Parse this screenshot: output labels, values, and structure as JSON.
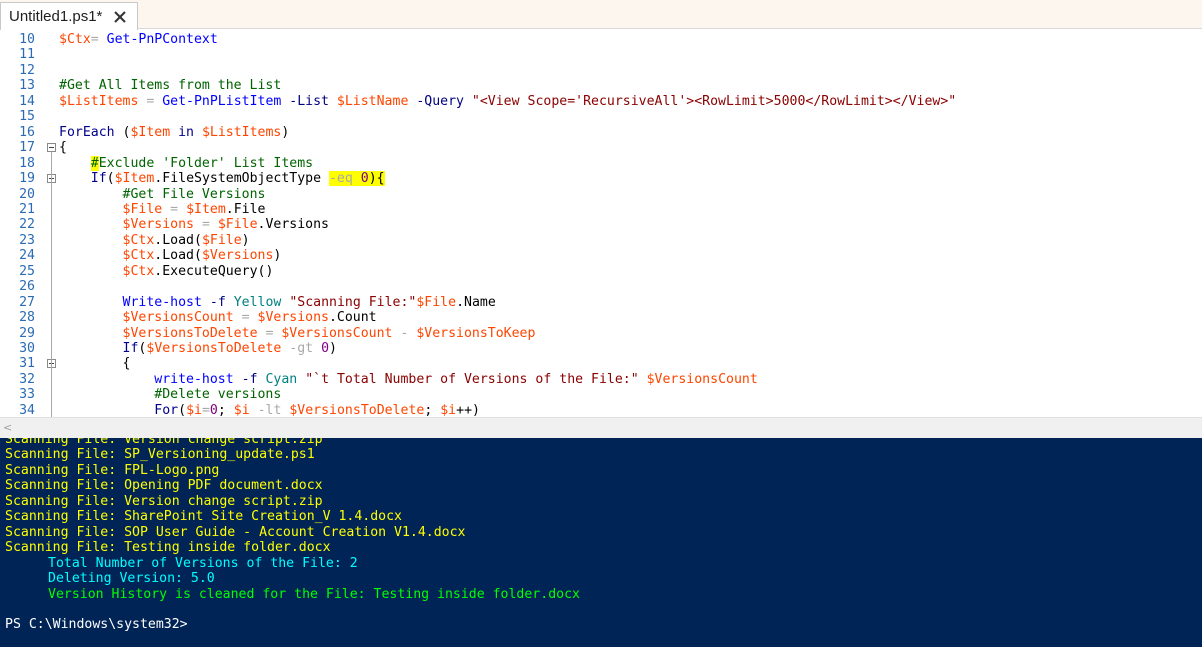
{
  "tab": {
    "title": "Untitled1.ps1*",
    "close_icon": "close-icon"
  },
  "editor": {
    "lines": [
      {
        "num": "10",
        "tokens": [
          {
            "t": "$Ctx",
            "c": "var"
          },
          {
            "t": "= ",
            "c": "op"
          },
          {
            "t": "Get-PnPContext",
            "c": "cmd"
          }
        ]
      },
      {
        "num": "11",
        "tokens": []
      },
      {
        "num": "12",
        "tokens": []
      },
      {
        "num": "13",
        "tokens": [
          {
            "t": "#Get All Items from the List",
            "c": "cmt"
          }
        ]
      },
      {
        "num": "14",
        "tokens": [
          {
            "t": "$ListItems",
            "c": "var"
          },
          {
            "t": " = ",
            "c": "op"
          },
          {
            "t": "Get-PnPListItem",
            "c": "cmd"
          },
          {
            "t": " -List",
            "c": "par"
          },
          {
            "t": " ",
            "c": "mem"
          },
          {
            "t": "$ListName",
            "c": "var"
          },
          {
            "t": " -Query",
            "c": "par"
          },
          {
            "t": " ",
            "c": "mem"
          },
          {
            "t": "\"<View Scope='RecursiveAll'><RowLimit>5000</RowLimit></View>\"",
            "c": "str"
          }
        ]
      },
      {
        "num": "15",
        "tokens": []
      },
      {
        "num": "16",
        "tokens": [
          {
            "t": "ForEach",
            "c": "key"
          },
          {
            "t": " (",
            "c": "mem"
          },
          {
            "t": "$Item",
            "c": "var"
          },
          {
            "t": " in ",
            "c": "key"
          },
          {
            "t": "$ListItems",
            "c": "var"
          },
          {
            "t": ")",
            "c": "mem"
          }
        ]
      },
      {
        "num": "17",
        "fold": true,
        "tokens": [
          {
            "t": "{",
            "c": "mem"
          }
        ]
      },
      {
        "num": "18",
        "tokens": [
          {
            "t": "    ",
            "c": "mem"
          },
          {
            "t": "#",
            "c": "cmt",
            "hl": true
          },
          {
            "t": "Exclude 'Folder' List Items",
            "c": "cmt"
          }
        ]
      },
      {
        "num": "19",
        "fold": true,
        "tokens": [
          {
            "t": "    ",
            "c": "mem"
          },
          {
            "t": "If",
            "c": "key"
          },
          {
            "t": "(",
            "c": "mem"
          },
          {
            "t": "$Item",
            "c": "var"
          },
          {
            "t": ".FileSystemObjectType ",
            "c": "mem"
          },
          {
            "t": "-eq",
            "c": "op",
            "hl": true
          },
          {
            "t": " 0",
            "c": "num",
            "hl": true
          },
          {
            "t": ")",
            "c": "mem",
            "hl": true
          },
          {
            "t": "{",
            "c": "mem",
            "hl": true
          }
        ]
      },
      {
        "num": "20",
        "tokens": [
          {
            "t": "        ",
            "c": "mem"
          },
          {
            "t": "#Get File Versions",
            "c": "cmt"
          }
        ]
      },
      {
        "num": "21",
        "tokens": [
          {
            "t": "        ",
            "c": "mem"
          },
          {
            "t": "$File",
            "c": "var"
          },
          {
            "t": " = ",
            "c": "op"
          },
          {
            "t": "$Item",
            "c": "var"
          },
          {
            "t": ".File",
            "c": "mem"
          }
        ]
      },
      {
        "num": "22",
        "tokens": [
          {
            "t": "        ",
            "c": "mem"
          },
          {
            "t": "$Versions",
            "c": "var"
          },
          {
            "t": " = ",
            "c": "op"
          },
          {
            "t": "$File",
            "c": "var"
          },
          {
            "t": ".Versions",
            "c": "mem"
          }
        ]
      },
      {
        "num": "23",
        "tokens": [
          {
            "t": "        ",
            "c": "mem"
          },
          {
            "t": "$Ctx",
            "c": "var"
          },
          {
            "t": ".Load(",
            "c": "mem"
          },
          {
            "t": "$File",
            "c": "var"
          },
          {
            "t": ")",
            "c": "mem"
          }
        ]
      },
      {
        "num": "24",
        "tokens": [
          {
            "t": "        ",
            "c": "mem"
          },
          {
            "t": "$Ctx",
            "c": "var"
          },
          {
            "t": ".Load(",
            "c": "mem"
          },
          {
            "t": "$Versions",
            "c": "var"
          },
          {
            "t": ")",
            "c": "mem"
          }
        ]
      },
      {
        "num": "25",
        "tokens": [
          {
            "t": "        ",
            "c": "mem"
          },
          {
            "t": "$Ctx",
            "c": "var"
          },
          {
            "t": ".ExecuteQuery()",
            "c": "mem"
          }
        ]
      },
      {
        "num": "26",
        "tokens": []
      },
      {
        "num": "27",
        "tokens": [
          {
            "t": "        ",
            "c": "mem"
          },
          {
            "t": "Write-host",
            "c": "cmd"
          },
          {
            "t": " -f",
            "c": "par"
          },
          {
            "t": " ",
            "c": "mem"
          },
          {
            "t": "Yellow",
            "c": "typ"
          },
          {
            "t": " ",
            "c": "mem"
          },
          {
            "t": "\"Scanning File:\"",
            "c": "str"
          },
          {
            "t": "$File",
            "c": "var"
          },
          {
            "t": ".Name",
            "c": "mem"
          }
        ]
      },
      {
        "num": "28",
        "tokens": [
          {
            "t": "        ",
            "c": "mem"
          },
          {
            "t": "$VersionsCount",
            "c": "var"
          },
          {
            "t": " = ",
            "c": "op"
          },
          {
            "t": "$Versions",
            "c": "var"
          },
          {
            "t": ".Count",
            "c": "mem"
          }
        ]
      },
      {
        "num": "29",
        "tokens": [
          {
            "t": "        ",
            "c": "mem"
          },
          {
            "t": "$VersionsToDelete",
            "c": "var"
          },
          {
            "t": " = ",
            "c": "op"
          },
          {
            "t": "$VersionsCount",
            "c": "var"
          },
          {
            "t": " - ",
            "c": "op"
          },
          {
            "t": "$VersionsToKeep",
            "c": "var"
          }
        ]
      },
      {
        "num": "30",
        "tokens": [
          {
            "t": "        ",
            "c": "mem"
          },
          {
            "t": "If",
            "c": "key"
          },
          {
            "t": "(",
            "c": "mem"
          },
          {
            "t": "$VersionsToDelete",
            "c": "var"
          },
          {
            "t": " -gt",
            "c": "op"
          },
          {
            "t": " 0",
            "c": "num"
          },
          {
            "t": ")",
            "c": "mem"
          }
        ]
      },
      {
        "num": "31",
        "fold": true,
        "tokens": [
          {
            "t": "        ",
            "c": "mem"
          },
          {
            "t": "{",
            "c": "mem"
          }
        ]
      },
      {
        "num": "32",
        "tokens": [
          {
            "t": "            ",
            "c": "mem"
          },
          {
            "t": "write-host",
            "c": "cmd"
          },
          {
            "t": " -f",
            "c": "par"
          },
          {
            "t": " ",
            "c": "mem"
          },
          {
            "t": "Cyan",
            "c": "typ"
          },
          {
            "t": " ",
            "c": "mem"
          },
          {
            "t": "\"`t Total Number of Versions of the File:\"",
            "c": "str"
          },
          {
            "t": " ",
            "c": "mem"
          },
          {
            "t": "$VersionsCount",
            "c": "var"
          }
        ]
      },
      {
        "num": "33",
        "tokens": [
          {
            "t": "            ",
            "c": "mem"
          },
          {
            "t": "#Delete versions",
            "c": "cmt"
          }
        ]
      },
      {
        "num": "34",
        "tokens": [
          {
            "t": "            ",
            "c": "mem"
          },
          {
            "t": "For",
            "c": "key"
          },
          {
            "t": "(",
            "c": "mem"
          },
          {
            "t": "$i",
            "c": "var"
          },
          {
            "t": "=",
            "c": "op"
          },
          {
            "t": "0",
            "c": "num"
          },
          {
            "t": "; ",
            "c": "mem"
          },
          {
            "t": "$i",
            "c": "var"
          },
          {
            "t": " -lt",
            "c": "op"
          },
          {
            "t": " ",
            "c": "mem"
          },
          {
            "t": "$VersionsToDelete",
            "c": "var"
          },
          {
            "t": "; ",
            "c": "mem"
          },
          {
            "t": "$i",
            "c": "var"
          },
          {
            "t": "++)",
            "c": "mem"
          }
        ]
      }
    ]
  },
  "console": {
    "lines": [
      {
        "text": "Scanning File: Version change script.zip",
        "color": "yellow",
        "indent": false
      },
      {
        "text": "Scanning File: SP_Versioning_update.ps1",
        "color": "yellow",
        "indent": false
      },
      {
        "text": "Scanning File: FPL-Logo.png",
        "color": "yellow",
        "indent": false
      },
      {
        "text": "Scanning File: Opening PDF document.docx",
        "color": "yellow",
        "indent": false
      },
      {
        "text": "Scanning File: Version change script.zip",
        "color": "yellow",
        "indent": false
      },
      {
        "text": "Scanning File: SharePoint Site Creation_V 1.4.docx",
        "color": "yellow",
        "indent": false
      },
      {
        "text": "Scanning File: SOP User Guide - Account Creation V1.4.docx",
        "color": "yellow",
        "indent": false
      },
      {
        "text": "Scanning File: Testing inside folder.docx",
        "color": "yellow",
        "indent": false
      },
      {
        "text": "Total Number of Versions of the File: 2",
        "color": "cyan",
        "indent": true
      },
      {
        "text": "Deleting Version: 5.0",
        "color": "cyan",
        "indent": true
      },
      {
        "text": "Version History is cleaned for the File: Testing inside folder.docx",
        "color": "green",
        "indent": true
      },
      {
        "text": "",
        "color": "white",
        "indent": false
      },
      {
        "text": "PS C:\\Windows\\system32>",
        "color": "white",
        "indent": false
      }
    ]
  },
  "colors": {
    "console_bg": "#012456",
    "highlight": "#ffff00",
    "line_number": "#2b6bb3"
  }
}
